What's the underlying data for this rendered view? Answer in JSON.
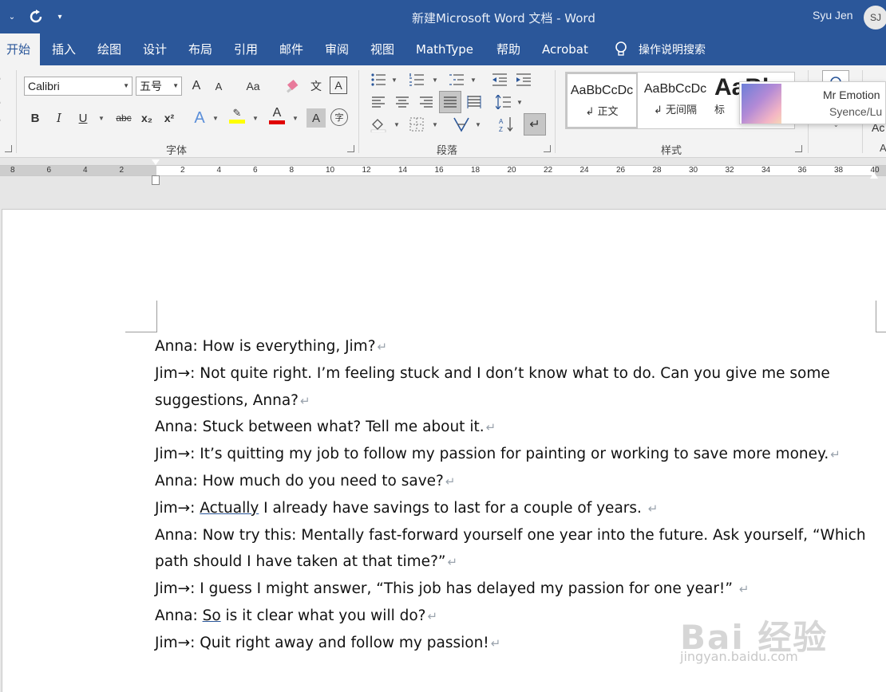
{
  "titlebar": {
    "title": "新建Microsoft Word 文档  -  Word",
    "user_name": "Syu Jen",
    "user_initials": "SJ",
    "customize_arrow": "▾"
  },
  "tabs": [
    {
      "label": "开始",
      "active": true
    },
    {
      "label": "插入"
    },
    {
      "label": "绘图"
    },
    {
      "label": "设计"
    },
    {
      "label": "布局"
    },
    {
      "label": "引用"
    },
    {
      "label": "邮件"
    },
    {
      "label": "审阅"
    },
    {
      "label": "视图"
    },
    {
      "label": "MathType"
    },
    {
      "label": "帮助"
    },
    {
      "label": "Acrobat"
    }
  ],
  "tell_me": "操作说明搜索",
  "font_group": {
    "label": "字体",
    "font_name": "Calibri",
    "font_size": "五号",
    "grow_glyph": "A",
    "shrink_glyph": "A",
    "case_glyph": "Aa",
    "phonetic_glyph": "文",
    "bold_glyph": "B",
    "italic_glyph": "I",
    "underline_glyph": "U",
    "strike_glyph": "abc",
    "subscript_glyph": "x₂",
    "superscript_glyph": "x²",
    "effects_glyph": "A",
    "font_color_glyph": "A",
    "shading_glyph": "A",
    "enclose_glyph": "字",
    "border_glyph": "A"
  },
  "paragraph_group": {
    "label": "段落"
  },
  "styles_group": {
    "label": "样式",
    "items": [
      {
        "sample": "AaBbCcDc",
        "name": "↲ 正文"
      },
      {
        "sample": "AaBbCcDc",
        "name": "↲ 无间隔"
      },
      {
        "sample": "AaBl",
        "name": "标"
      }
    ]
  },
  "edit_group": {
    "label_fragment": "Ac"
  },
  "music_popup": {
    "title": "Mr Emotion",
    "artist": "Syence/Lu"
  },
  "ruler": {
    "numbers": [
      "8",
      "6",
      "4",
      "2",
      "2",
      "4",
      "6",
      "8",
      "10",
      "12",
      "14",
      "16",
      "18",
      "20",
      "22",
      "24",
      "26",
      "28",
      "30",
      "32",
      "34",
      "36",
      "38",
      "40"
    ]
  },
  "document": {
    "paragraphs": [
      {
        "speaker": "Anna:",
        "parts": [
          {
            "text": " How is everything, Jim?"
          }
        ]
      },
      {
        "speaker": "Jim→:",
        "parts": [
          {
            "text": " Not quite right. I’m feeling stuck and I don’t know what to do. Can you give me some"
          }
        ],
        "continuation": "suggestions, Anna?"
      },
      {
        "speaker": "Anna:",
        "parts": [
          {
            "text": " Stuck between what? Tell me about it."
          }
        ]
      },
      {
        "speaker": "Jim→:",
        "parts": [
          {
            "text": " It’s quitting my job to follow my passion for painting or working to save more money."
          }
        ]
      },
      {
        "speaker": "Anna:",
        "parts": [
          {
            "text": " How much do you need to save?"
          }
        ]
      },
      {
        "speaker": "Jim→:",
        "parts": [
          {
            "text": " "
          },
          {
            "text": "Actually",
            "underline": true
          },
          {
            "text": " I already have savings to last for a couple of years.  "
          }
        ]
      },
      {
        "speaker": "Anna:",
        "parts": [
          {
            "text": " Now try this: Mentally fast-forward yourself one year into the future. Ask yourself, “Which"
          }
        ],
        "continuation": "path should I have taken at that time?”"
      },
      {
        "speaker": "Jim→:",
        "parts": [
          {
            "text": " I guess I might answer, “This job has delayed my passion for one year!”  "
          }
        ]
      },
      {
        "speaker": "Anna:",
        "parts": [
          {
            "text": " "
          },
          {
            "text": "So",
            "underline": true
          },
          {
            "text": " is it clear what you will do?"
          }
        ]
      },
      {
        "speaker": "Jim→:",
        "parts": [
          {
            "text": " Quit right away and follow my passion!"
          }
        ]
      }
    ],
    "paragraph_mark": "↵"
  },
  "watermark": {
    "main": "Bai 经验",
    "sub": "jingyan.baidu.com"
  }
}
